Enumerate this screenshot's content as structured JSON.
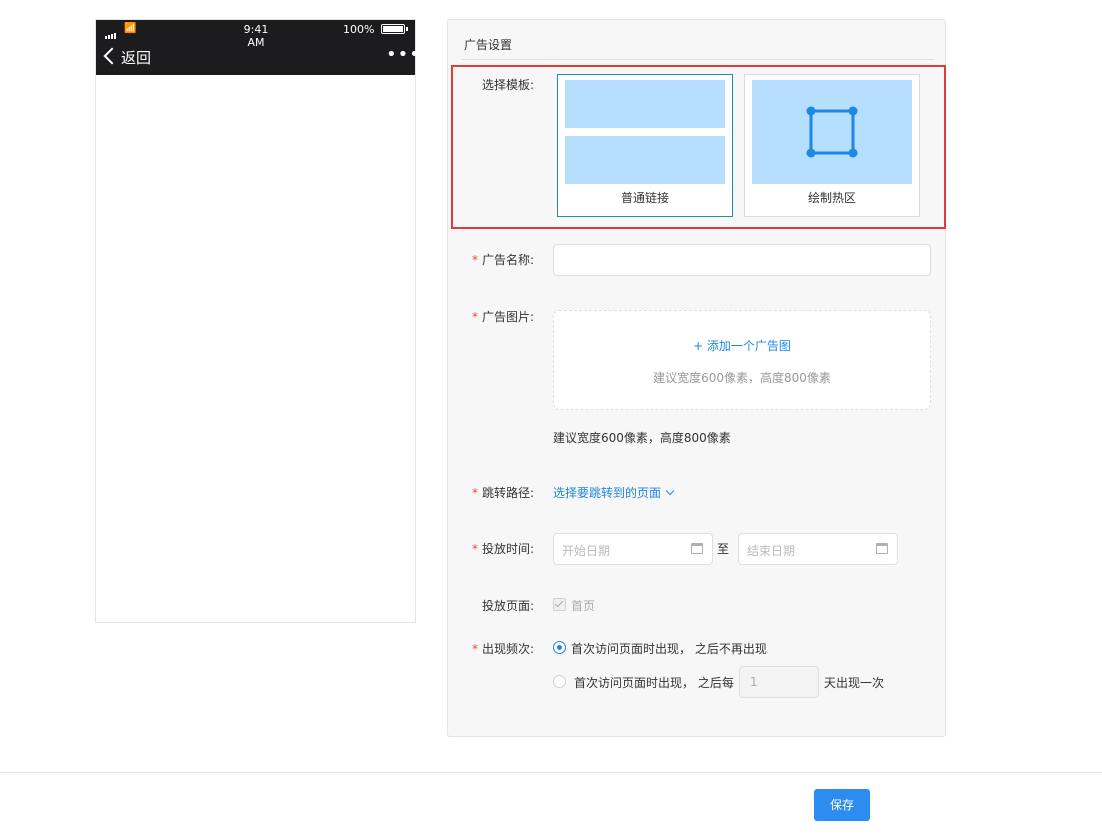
{
  "phone": {
    "time": "9:41 AM",
    "battery": "100%",
    "back_label": "返回",
    "more": "•••"
  },
  "panel": {
    "title": "广告设置",
    "template_label": "选择模板:",
    "templates": [
      {
        "label": "普通链接",
        "selected": true
      },
      {
        "label": "绘制热区",
        "selected": false
      }
    ],
    "name": {
      "label": "广告名称:",
      "value": "",
      "required": true
    },
    "image": {
      "label": "广告图片:",
      "add": "+ 添加一个广告图",
      "hint": "建议宽度600像素，高度800像素",
      "below_hint": "建议宽度600像素，高度800像素"
    },
    "path": {
      "label": "跳转路径:",
      "link": "选择要跳转到的页面"
    },
    "time": {
      "label": "投放时间:",
      "start_placeholder": "开始日期",
      "separator": "至",
      "end_placeholder": "结束日期"
    },
    "pages": {
      "label": "投放页面:",
      "option": "首页",
      "checked": true
    },
    "frequency": {
      "label": "出现频次:",
      "option1": "首次访问页面时出现， 之后不再出现",
      "option2_prefix": "首次访问页面时出现， 之后每",
      "option2_value": "1",
      "option2_suffix": "天出现一次",
      "selected": 1
    },
    "required_mark": "*"
  },
  "footer": {
    "save": "保存"
  },
  "colors": {
    "accent": "#2d8cf0",
    "highlight": "#e53935",
    "template_block": "#b6defd",
    "hotzone": "#1e88e5"
  }
}
